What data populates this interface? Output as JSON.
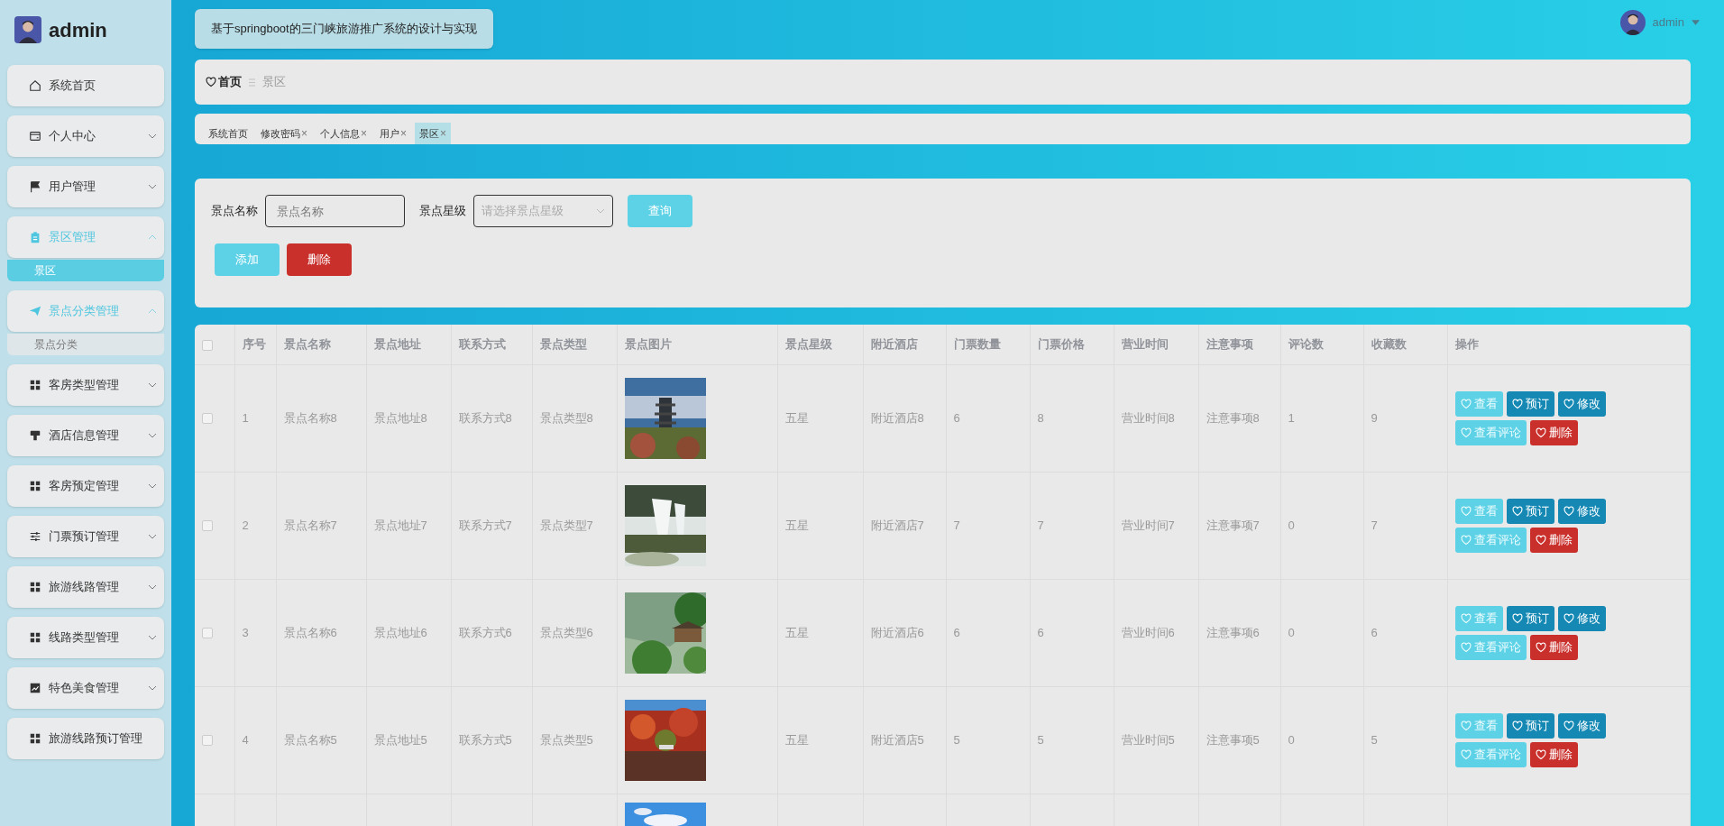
{
  "sidebar": {
    "user": "admin",
    "items": [
      {
        "label": "系统首页",
        "active": false,
        "has_arrow": false
      },
      {
        "label": "个人中心",
        "active": false,
        "expanded": false,
        "has_arrow": true
      },
      {
        "label": "用户管理",
        "active": false,
        "expanded": false,
        "has_arrow": true
      },
      {
        "label": "景区管理",
        "active": true,
        "expanded": true,
        "has_arrow": true,
        "children": [
          {
            "label": "景区",
            "selected": true
          }
        ]
      },
      {
        "label": "景点分类管理",
        "active": true,
        "expanded": true,
        "has_arrow": true,
        "children": [
          {
            "label": "景点分类",
            "selected": false
          }
        ]
      },
      {
        "label": "客房类型管理",
        "active": false,
        "expanded": false,
        "has_arrow": true
      },
      {
        "label": "酒店信息管理",
        "active": false,
        "expanded": false,
        "has_arrow": true
      },
      {
        "label": "客房预定管理",
        "active": false,
        "expanded": false,
        "has_arrow": true
      },
      {
        "label": "门票预订管理",
        "active": false,
        "expanded": false,
        "has_arrow": true
      },
      {
        "label": "旅游线路管理",
        "active": false,
        "expanded": false,
        "has_arrow": true
      },
      {
        "label": "线路类型管理",
        "active": false,
        "expanded": false,
        "has_arrow": true
      },
      {
        "label": "特色美食管理",
        "active": false,
        "expanded": false,
        "has_arrow": true
      },
      {
        "label": "旅游线路预订管理",
        "active": false,
        "has_arrow": false
      }
    ]
  },
  "header": {
    "title": "基于springboot的三门峡旅游推广系统的设计与实现",
    "user": "admin"
  },
  "breadcrumb": {
    "home": "首页",
    "current": "景区"
  },
  "tabs": [
    {
      "label": "系统首页",
      "selected": false
    },
    {
      "label": "修改密码",
      "close": "×",
      "selected": false
    },
    {
      "label": "个人信息",
      "close": "×",
      "selected": false
    },
    {
      "label": "用户",
      "close": "×",
      "selected": false
    },
    {
      "label": "景区",
      "close": "×",
      "selected": true
    }
  ],
  "search": {
    "name_label": "景点名称",
    "name_placeholder": "景点名称",
    "star_label": "景点星级",
    "star_placeholder": "请选择景点星级",
    "query": "查询",
    "add": "添加",
    "delete": "删除"
  },
  "table": {
    "all_checked": false,
    "columns": [
      "序号",
      "景点名称",
      "景点地址",
      "联系方式",
      "景点类型",
      "景点图片",
      "景点星级",
      "附近酒店",
      "门票数量",
      "门票价格",
      "营业时间",
      "注意事项",
      "评论数",
      "收藏数",
      "操作"
    ],
    "rows": [
      {
        "checked": false,
        "cells": [
          "1",
          "景点名称8",
          "景点地址8",
          "联系方式8",
          "景点类型8",
          "五星",
          "附近酒店8",
          "6",
          "8",
          "营业时间8",
          "注意事项8",
          "1",
          "9"
        ],
        "actions": [
          {
            "kind": "view",
            "label": "查看"
          },
          {
            "kind": "book",
            "label": "预订"
          },
          {
            "kind": "edit",
            "label": "修改"
          },
          {
            "kind": "comments",
            "label": "查看评论"
          },
          {
            "kind": "delete",
            "label": "删除"
          }
        ]
      },
      {
        "checked": false,
        "cells": [
          "2",
          "景点名称7",
          "景点地址7",
          "联系方式7",
          "景点类型7",
          "五星",
          "附近酒店7",
          "7",
          "7",
          "营业时间7",
          "注意事项7",
          "0",
          "7"
        ],
        "actions": [
          {
            "kind": "view",
            "label": "查看"
          },
          {
            "kind": "book",
            "label": "预订"
          },
          {
            "kind": "edit",
            "label": "修改"
          },
          {
            "kind": "comments",
            "label": "查看评论"
          },
          {
            "kind": "delete",
            "label": "删除"
          }
        ]
      },
      {
        "checked": false,
        "cells": [
          "3",
          "景点名称6",
          "景点地址6",
          "联系方式6",
          "景点类型6",
          "五星",
          "附近酒店6",
          "6",
          "6",
          "营业时间6",
          "注意事项6",
          "0",
          "6"
        ],
        "actions": [
          {
            "kind": "view",
            "label": "查看"
          },
          {
            "kind": "book",
            "label": "预订"
          },
          {
            "kind": "edit",
            "label": "修改"
          },
          {
            "kind": "comments",
            "label": "查看评论"
          },
          {
            "kind": "delete",
            "label": "删除"
          }
        ]
      },
      {
        "checked": false,
        "cells": [
          "4",
          "景点名称5",
          "景点地址5",
          "联系方式5",
          "景点类型5",
          "五星",
          "附近酒店5",
          "5",
          "5",
          "营业时间5",
          "注意事项5",
          "0",
          "5"
        ],
        "actions": [
          {
            "kind": "view",
            "label": "查看"
          },
          {
            "kind": "book",
            "label": "预订"
          },
          {
            "kind": "edit",
            "label": "修改"
          },
          {
            "kind": "comments",
            "label": "查看评论"
          },
          {
            "kind": "delete",
            "label": "删除"
          }
        ]
      },
      {
        "kind": "partial"
      }
    ]
  }
}
